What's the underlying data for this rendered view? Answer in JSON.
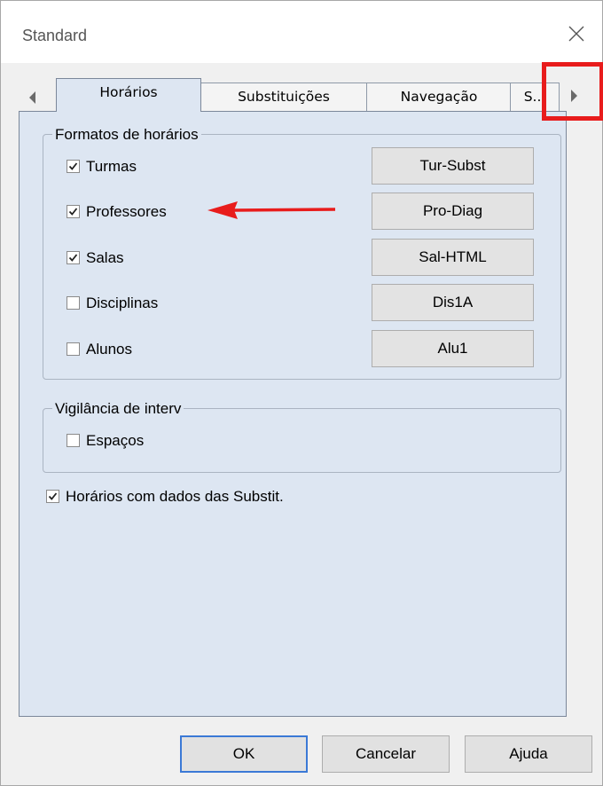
{
  "window": {
    "title": "Standard"
  },
  "tabs": [
    {
      "label": "Horários",
      "active": true
    },
    {
      "label": "Substituições",
      "active": false
    },
    {
      "label": "Navegação",
      "active": false
    },
    {
      "label": "S...",
      "active": false
    }
  ],
  "formats_group": {
    "legend": "Formatos de horários",
    "rows": [
      {
        "label": "Turmas",
        "checked": true,
        "button": "Tur-Subst"
      },
      {
        "label": "Professores",
        "checked": true,
        "button": "Pro-Diag"
      },
      {
        "label": "Salas",
        "checked": true,
        "button": "Sal-HTML"
      },
      {
        "label": "Disciplinas",
        "checked": false,
        "button": "Dis1A"
      },
      {
        "label": "Alunos",
        "checked": false,
        "button": "Alu1"
      }
    ]
  },
  "interval_group": {
    "legend": "Vigilância de interv",
    "option": {
      "label": "Espaços",
      "checked": false
    }
  },
  "subst_option": {
    "label": "Horários com dados das Substit.",
    "checked": true
  },
  "footer": {
    "ok": "OK",
    "cancel": "Cancelar",
    "help": "Ajuda"
  },
  "colors": {
    "annotation": "#e81c1c",
    "panel": "#dde6f2",
    "default_button_border": "#3b79d6"
  },
  "icons": {
    "close": "close-icon",
    "scroll_left": "scroll-left-icon",
    "scroll_right": "scroll-right-icon",
    "check": "check-icon"
  }
}
